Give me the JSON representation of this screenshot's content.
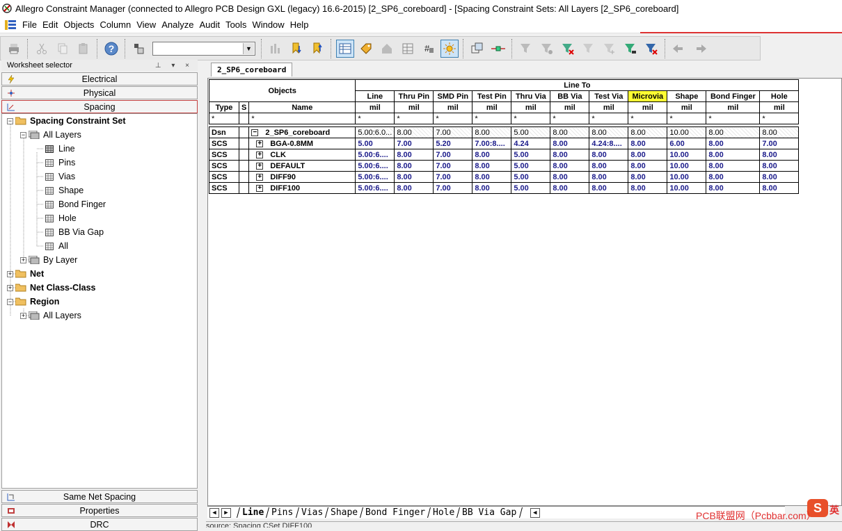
{
  "window": {
    "title": "Allegro Constraint Manager (connected to Allegro PCB Design GXL (legacy) 16.6-2015) [2_SP6_coreboard] - [Spacing Constraint Sets:  All Layers [2_SP6_coreboard]"
  },
  "menu": {
    "items": [
      "File",
      "Edit",
      "Objects",
      "Column",
      "View",
      "Analyze",
      "Audit",
      "Tools",
      "Window",
      "Help"
    ]
  },
  "worksheet": {
    "header": "Worksheet selector",
    "pins": "⊥ ▾ ×",
    "categories": {
      "electrical": "Electrical",
      "physical": "Physical",
      "spacing": "Spacing",
      "same_net": "Same Net Spacing",
      "properties": "Properties",
      "drc": "DRC"
    },
    "tree": {
      "spacing_cset": "Spacing Constraint Set",
      "all_layers": "All Layers",
      "line": "Line",
      "pins": "Pins",
      "vias": "Vias",
      "shape": "Shape",
      "bond_finger": "Bond Finger",
      "hole": "Hole",
      "bb_via_gap": "BB Via Gap",
      "all": "All",
      "by_layer": "By Layer",
      "net": "Net",
      "net_class_class": "Net Class-Class",
      "region": "Region",
      "region_all_layers": "All Layers"
    }
  },
  "sheet": {
    "tab": "2_SP6_coreboard",
    "objects_label": "Objects",
    "group_label": "Line To",
    "type_label": "Type",
    "s_label": "S",
    "name_label": "Name",
    "filter": "*",
    "columns": [
      {
        "label": "Line",
        "unit": "mil"
      },
      {
        "label": "Thru Pin",
        "unit": "mil"
      },
      {
        "label": "SMD Pin",
        "unit": "mil"
      },
      {
        "label": "Test Pin",
        "unit": "mil"
      },
      {
        "label": "Thru Via",
        "unit": "mil"
      },
      {
        "label": "BB Via",
        "unit": "mil"
      },
      {
        "label": "Test Via",
        "unit": "mil"
      },
      {
        "label": "Microvia",
        "unit": "mil"
      },
      {
        "label": "Shape",
        "unit": "mil"
      },
      {
        "label": "Bond Finger",
        "unit": "mil"
      },
      {
        "label": "Hole",
        "unit": "mil"
      }
    ],
    "rows": [
      {
        "type": "Dsn",
        "name": "2_SP6_coreboard",
        "values": [
          "5.00:6.0...",
          "8.00",
          "7.00",
          "8.00",
          "5.00",
          "8.00",
          "8.00",
          "8.00",
          "10.00",
          "8.00",
          "8.00"
        ]
      },
      {
        "type": "SCS",
        "name": "BGA-0.8MM",
        "values": [
          "5.00",
          "7.00",
          "5.20",
          "7.00:8....",
          "4.24",
          "8.00",
          "4.24:8....",
          "8.00",
          "6.00",
          "8.00",
          "7.00"
        ]
      },
      {
        "type": "SCS",
        "name": "CLK",
        "values": [
          "5.00:6....",
          "8.00",
          "7.00",
          "8.00",
          "5.00",
          "8.00",
          "8.00",
          "8.00",
          "10.00",
          "8.00",
          "8.00"
        ]
      },
      {
        "type": "SCS",
        "name": "DEFAULT",
        "values": [
          "5.00:6....",
          "8.00",
          "7.00",
          "8.00",
          "5.00",
          "8.00",
          "8.00",
          "8.00",
          "10.00",
          "8.00",
          "8.00"
        ]
      },
      {
        "type": "SCS",
        "name": "DIFF90",
        "values": [
          "5.00:6....",
          "8.00",
          "7.00",
          "8.00",
          "5.00",
          "8.00",
          "8.00",
          "8.00",
          "10.00",
          "8.00",
          "8.00"
        ]
      },
      {
        "type": "SCS",
        "name": "DIFF100",
        "values": [
          "5.00:6....",
          "8.00",
          "7.00",
          "8.00",
          "5.00",
          "8.00",
          "8.00",
          "8.00",
          "10.00",
          "8.00",
          "8.00"
        ]
      }
    ]
  },
  "bottom_tabs": [
    "Line",
    "Pins",
    "Vias",
    "Shape",
    "Bond Finger",
    "Hole",
    "BB Via Gap"
  ],
  "status": "source: Spacing CSet DIFF100",
  "watermark": "PCB联盟网（Pcbbar.com）",
  "watermark_logo": "S",
  "watermark_char": "英",
  "colors": {
    "highlight": "#ffff33",
    "value_text": "#1a1a8a",
    "accent_red": "#e03030"
  }
}
